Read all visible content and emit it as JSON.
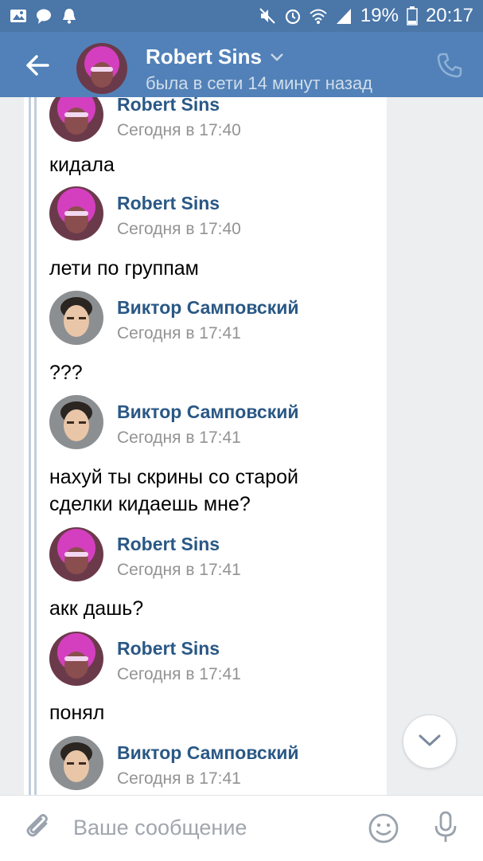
{
  "status_bar": {
    "battery": "19%",
    "time": "20:17"
  },
  "header": {
    "name": "Robert Sins",
    "status": "была в сети 14 минут назад"
  },
  "compose": {
    "placeholder": "Ваше сообщение"
  },
  "messages": [
    {
      "author": "Robert Sins",
      "time": "Сегодня в 17:40",
      "text": "кидала"
    },
    {
      "author": "Robert Sins",
      "time": "Сегодня в 17:40",
      "text": "лети по группам"
    },
    {
      "author": "Виктор Самповский",
      "time": "Сегодня в 17:41",
      "text": "???"
    },
    {
      "author": "Виктор Самповский",
      "time": "Сегодня в 17:41",
      "text": "нахуй ты скрины со старой сделки кидаешь мне?"
    },
    {
      "author": "Robert Sins",
      "time": "Сегодня в 17:41",
      "text": "акк дашь?"
    },
    {
      "author": "Robert Sins",
      "time": "Сегодня в 17:41",
      "text": "понял"
    },
    {
      "author": "Виктор Самповский",
      "time": "Сегодня в 17:41",
      "text": ""
    }
  ],
  "colors": {
    "header": "#5181b8",
    "status_bar": "#4a76a8",
    "link": "#2a5885",
    "time": "#939393"
  },
  "icons": [
    "image-icon",
    "chat-icon",
    "bell-icon",
    "mute-icon",
    "alarm-icon",
    "wifi-icon",
    "signal-icon",
    "battery-icon",
    "back-arrow-icon",
    "chevron-down-icon",
    "phone-icon",
    "attach-icon",
    "smile-icon",
    "mic-icon"
  ]
}
